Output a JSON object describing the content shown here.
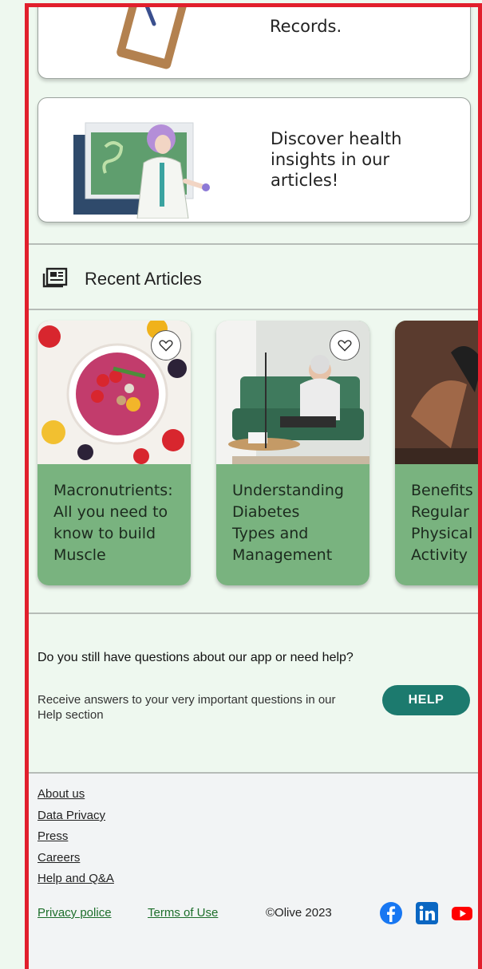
{
  "cards": {
    "records_text": "Records.",
    "articles_text": "Discover health\n insights in our\narticles!"
  },
  "recent": {
    "title": "Recent Articles",
    "articles": [
      {
        "title": "Macronutrients:",
        "subtitle": "All you need to\nknow to build\nMuscle"
      },
      {
        "title": "Understanding\nDiabetes",
        "subtitle": "Types and\nManagement"
      },
      {
        "title": "Benefits",
        "subtitle": "Regular\nPhysical\nActivity"
      }
    ]
  },
  "help": {
    "question": "Do you still have questions about our app or need help?",
    "answer": "Receive answers to your very important questions in our Help section",
    "button": "HELP"
  },
  "footer": {
    "links": [
      "About us",
      "Data Privacy",
      "Press",
      "Careers",
      "Help and Q&A"
    ],
    "privacy": "Privacy police",
    "terms": "Terms of Use",
    "copyright": "©Olive 2023"
  },
  "icons": {
    "newspaper": "newspaper-icon",
    "heart": "heart-outline-icon",
    "facebook": "facebook-icon",
    "linkedin": "linkedin-icon",
    "youtube": "youtube-icon"
  },
  "colors": {
    "accent": "#1c7a6e",
    "card_green": "#79b37f",
    "border_red": "#e11f2c",
    "link_green": "#1c6e2a"
  }
}
